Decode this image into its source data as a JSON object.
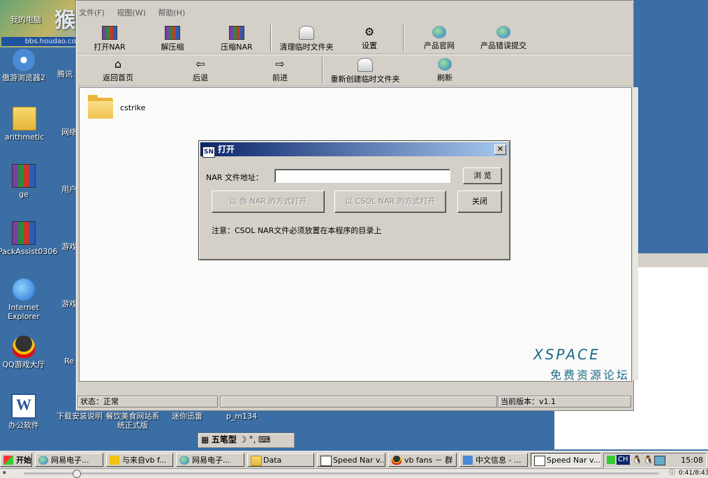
{
  "window": {
    "title": "Speed Nar V1.1 - xspace免费资源论坛",
    "menu": [
      "文件(F)",
      "视图(W)",
      "帮助(H)"
    ]
  },
  "watermark": {
    "name": "猴岛",
    "url": "bbs.houdao.com"
  },
  "toolbar1": [
    {
      "label": "打开NAR",
      "icon": "rar-icon"
    },
    {
      "label": "解压缩",
      "icon": "rar-icon"
    },
    {
      "label": "压缩NAR",
      "icon": "rar-icon"
    },
    {
      "label": "清理临时文件夹",
      "icon": "cleanup-icon"
    },
    {
      "label": "设置",
      "icon": "settings-icon"
    },
    {
      "label": "产品官网",
      "icon": "ie-icon"
    },
    {
      "label": "产品错误提交",
      "icon": "ie-icon"
    }
  ],
  "toolbar2": [
    {
      "label": "返回首页",
      "icon": "home-icon"
    },
    {
      "label": "后退",
      "icon": "back-arrow-icon"
    },
    {
      "label": "前进",
      "icon": "forward-arrow-icon"
    },
    {
      "label": "重新创建临时文件夹",
      "icon": "recreate-folder-icon"
    },
    {
      "label": "刷新",
      "icon": "refresh-icon"
    }
  ],
  "content": {
    "folder_name": "cstrike",
    "brand_line1": "XSPACE",
    "brand_line2": "免费资源论坛"
  },
  "status": {
    "left": "状态：正常",
    "middle": "",
    "right": "当前版本：v1.1"
  },
  "dialog": {
    "title": "打开",
    "nar_label": "NAR 文件地址：",
    "nar_value": "",
    "browse": "浏 览",
    "open_fake": "以 伪 NAR 的方式打开",
    "open_csol": "以 CSOL NAR 的方式打开",
    "close": "关闭",
    "note": "注意：CSOL NAR文件必须放置在本程序的目录上"
  },
  "desktop_icons": [
    {
      "label": "我的电脑"
    },
    {
      "label": "傲游浏览器2"
    },
    {
      "label": "arithmetic"
    },
    {
      "label": "ge"
    },
    {
      "label": "PackAssist0306"
    },
    {
      "label": "Internet Explorer"
    },
    {
      "label": "QQ游戏大厅"
    },
    {
      "label": "办公软件"
    },
    {
      "label": "下载安装说明"
    },
    {
      "label": "餐饮美食网站系统正式版"
    },
    {
      "label": "迷你迅雷"
    },
    {
      "label": "p_m134"
    },
    {
      "label": "腾讯"
    },
    {
      "label": "网络"
    },
    {
      "label": "用户"
    },
    {
      "label": "游戏"
    },
    {
      "label": "游戏"
    },
    {
      "label": "Re"
    }
  ],
  "ime": {
    "mode": "五笔型"
  },
  "taskbar": {
    "start": "开始",
    "tasks": [
      "网易电子...",
      "与来自vb f...",
      "网易电子...",
      "Data",
      "Speed Nar v...",
      "vb fans － 群",
      "中文信息 - ...",
      "Speed Nar v..."
    ],
    "lang": "CH",
    "clock": "15:08"
  },
  "player": {
    "time": "0:41/8:43"
  }
}
